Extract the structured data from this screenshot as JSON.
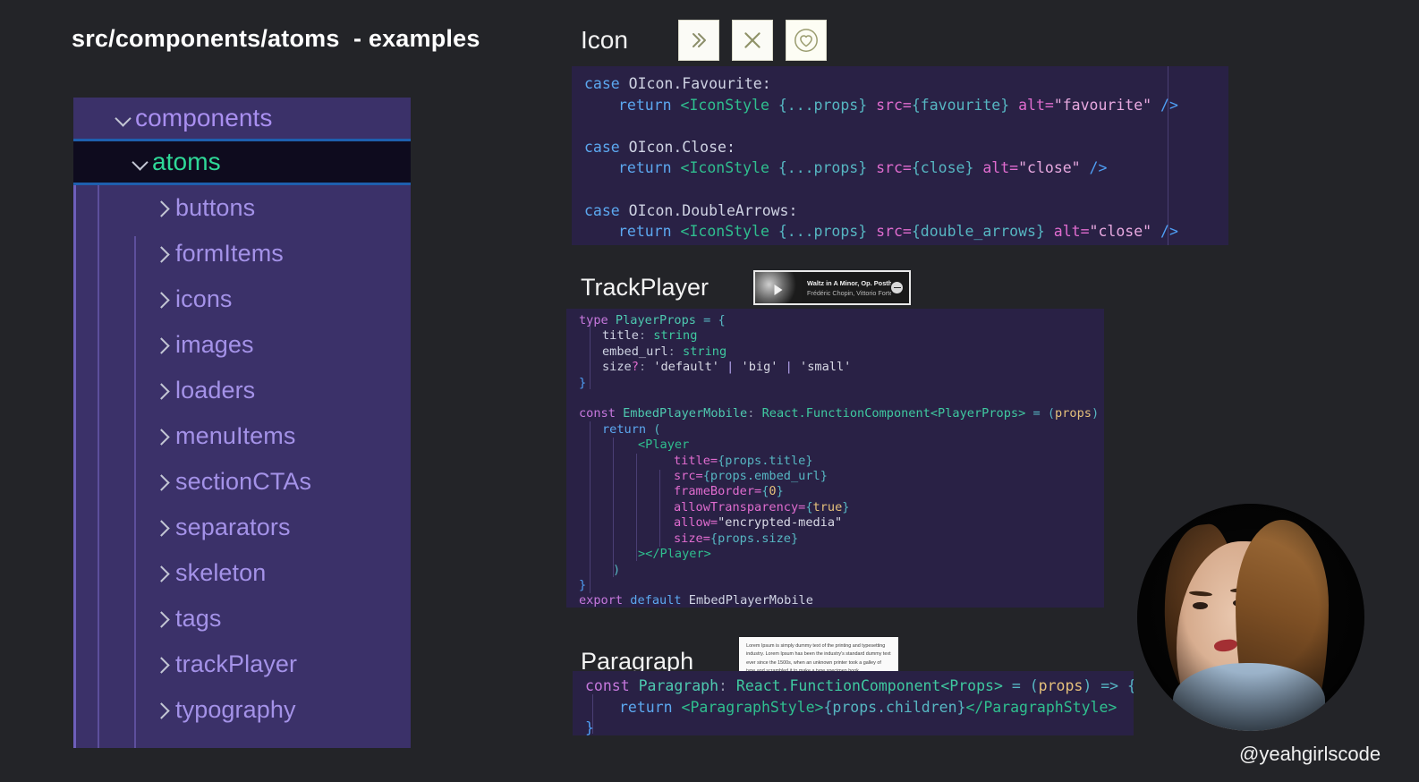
{
  "header": {
    "title": "src/components/atoms  - examples"
  },
  "sidebar": {
    "items": [
      {
        "label": "components",
        "icon": "chevron-down-icon",
        "level": 0,
        "state": "expanded",
        "selected": false
      },
      {
        "label": "atoms",
        "icon": "chevron-down-icon",
        "level": 1,
        "state": "expanded",
        "selected": true
      },
      {
        "label": "buttons",
        "icon": "chevron-right-icon",
        "level": 2,
        "state": "collapsed",
        "selected": false
      },
      {
        "label": "formItems",
        "icon": "chevron-right-icon",
        "level": 2,
        "state": "collapsed",
        "selected": false
      },
      {
        "label": "icons",
        "icon": "chevron-right-icon",
        "level": 2,
        "state": "collapsed",
        "selected": false
      },
      {
        "label": "images",
        "icon": "chevron-right-icon",
        "level": 2,
        "state": "collapsed",
        "selected": false
      },
      {
        "label": "loaders",
        "icon": "chevron-right-icon",
        "level": 2,
        "state": "collapsed",
        "selected": false
      },
      {
        "label": "menuItems",
        "icon": "chevron-right-icon",
        "level": 2,
        "state": "collapsed",
        "selected": false
      },
      {
        "label": "sectionCTAs",
        "icon": "chevron-right-icon",
        "level": 2,
        "state": "collapsed",
        "selected": false
      },
      {
        "label": "separators",
        "icon": "chevron-right-icon",
        "level": 2,
        "state": "collapsed",
        "selected": false
      },
      {
        "label": "skeleton",
        "icon": "chevron-right-icon",
        "level": 2,
        "state": "collapsed",
        "selected": false
      },
      {
        "label": "tags",
        "icon": "chevron-right-icon",
        "level": 2,
        "state": "collapsed",
        "selected": false
      },
      {
        "label": "trackPlayer",
        "icon": "chevron-right-icon",
        "level": 2,
        "state": "collapsed",
        "selected": false
      },
      {
        "label": "typography",
        "icon": "chevron-right-icon",
        "level": 2,
        "state": "collapsed",
        "selected": false
      }
    ]
  },
  "icon_section": {
    "label": "Icon",
    "buttons": [
      {
        "name": "double-arrows-icon",
        "glyph": "»",
        "alt": "double_arrows"
      },
      {
        "name": "close-icon",
        "glyph": "✕",
        "alt": "close"
      },
      {
        "name": "favourite-icon",
        "glyph": "♡",
        "alt": "favourite"
      }
    ],
    "code": {
      "case1_keyword": "case",
      "case1_label": " OIcon.Favourite:",
      "case1_return": "return",
      "case1_tag": "<IconStyle",
      "case1_props": " {...props} ",
      "case1_src_attr": "src=",
      "case1_src_val": "{favourite}",
      "case1_alt_attr": " alt=",
      "case1_alt_val": "\"favourite\"",
      "case1_close": " />",
      "case2_keyword": "case",
      "case2_label": " OIcon.Close:",
      "case2_return": "return",
      "case2_tag": "<IconStyle",
      "case2_props": " {...props} ",
      "case2_src_attr": "src=",
      "case2_src_val": "{close}",
      "case2_alt_attr": " alt=",
      "case2_alt_val": "\"close\"",
      "case2_close": " />",
      "case3_keyword": "case",
      "case3_label": " OIcon.DoubleArrows:",
      "case3_return": "return",
      "case3_tag": "<IconStyle",
      "case3_props": " {...props} ",
      "case3_src_attr": "src=",
      "case3_src_val": "{double_arrows}",
      "case3_alt_attr": " alt=",
      "case3_alt_val": "\"close\"",
      "case3_close": " />"
    }
  },
  "trackplayer_section": {
    "label": "TrackPlayer",
    "player": {
      "track_title": "Waltz in A Minor, Op. Posth...",
      "artist": "Frédéric Chopin, Vittorio Forte",
      "play_icon": "play-icon",
      "more_icon": "more-icon"
    },
    "code": {
      "l1_kw": "type",
      "l1_name": " PlayerProps",
      "l1_eq": " = {",
      "l2_key": "title",
      "l2_colon": ": ",
      "l2_type": "string",
      "l3_key": "embed_url",
      "l3_colon": ": ",
      "l3_type": "string",
      "l4_key": "size",
      "l4_opt": "?",
      "l4_colon": ": ",
      "l4_v1": "'default'",
      "l4_p1": " | ",
      "l4_v2": "'big'",
      "l4_p2": " | ",
      "l4_v3": "'small'",
      "l5_brace": "}",
      "l6_kw": "const",
      "l6_name": " EmbedPlayerMobile",
      "l6_colon": ": ",
      "l6_type": "React.FunctionComponent<PlayerProps>",
      "l6_eq": " = (",
      "l6_props": "props",
      "l6_arrow": ") => {",
      "l7_return": "return",
      "l7_paren": " (",
      "l8_tag": "<Player",
      "l9_attr": "title=",
      "l9_val": "{props.title}",
      "l10_attr": "src=",
      "l10_val": "{props.embed_url}",
      "l11_attr": "frameBorder=",
      "l11_val_open": "{",
      "l11_val_num": "0",
      "l11_val_close": "}",
      "l12_attr": "allowTransparency=",
      "l12_val_open": "{",
      "l12_val_num": "true",
      "l12_val_close": "}",
      "l13_attr": "allow=",
      "l13_val": "\"encrypted-media\"",
      "l14_attr": "size=",
      "l14_val": "{props.size}",
      "l15_close": "></Player>",
      "l16_paren": ")",
      "l17_brace": "}",
      "l18_export": "export",
      "l18_default": " default",
      "l18_name": " EmbedPlayerMobile"
    }
  },
  "paragraph_section": {
    "label": "Paragraph",
    "lorem": "Lorem Ipsum is simply dummy text of the printing and typesetting industry. Lorem Ipsum has been the industry's standard dummy text ever since the 1500s, when an unknown printer took a galley of type and scrambled it to make a type specimen book.",
    "code": {
      "l1_kw": "const",
      "l1_name": " Paragraph",
      "l1_colon": ": ",
      "l1_type": "React.FunctionComponent<Props>",
      "l1_eq": " = (",
      "l1_props": "props",
      "l1_arrow": ") => {",
      "l2_return": "return",
      "l2_open": " <ParagraphStyle>",
      "l2_children": "{props.children}",
      "l2_close": "</ParagraphStyle>",
      "l3_brace": "}"
    }
  },
  "webcam": {
    "handle": "@yeahgirlscode"
  },
  "colors": {
    "background": "#232428",
    "panel_purple": "#3b3169",
    "selected_row": "#0e0b1e",
    "selected_border": "#1e5fae",
    "code_bg": "#292145",
    "accent_green": "#2fd998",
    "tree_text": "#a492e8"
  }
}
